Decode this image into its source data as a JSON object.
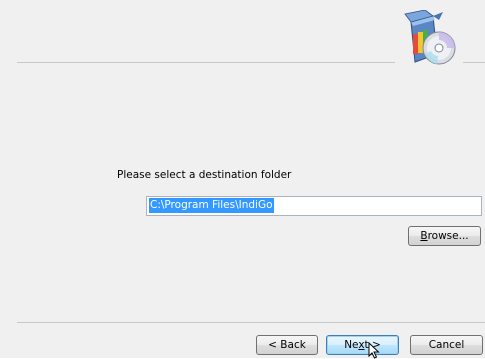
{
  "prompt_text": "Please select a destination folder",
  "destination": {
    "value": "C:\\Program Files\\IndiGo"
  },
  "buttons": {
    "browse": {
      "prefix": "",
      "accel": "B",
      "suffix": "rowse..."
    },
    "back": "< Back",
    "next": {
      "prefix": "Ne",
      "accel": "x",
      "suffix": "t >"
    },
    "cancel": "Cancel"
  },
  "icons": {
    "logo": "setup-disc-box-icon",
    "cursor": "mouse-pointer-icon"
  },
  "colors": {
    "selection": "#3399ff",
    "default_button_border": "#3c7fb1"
  }
}
